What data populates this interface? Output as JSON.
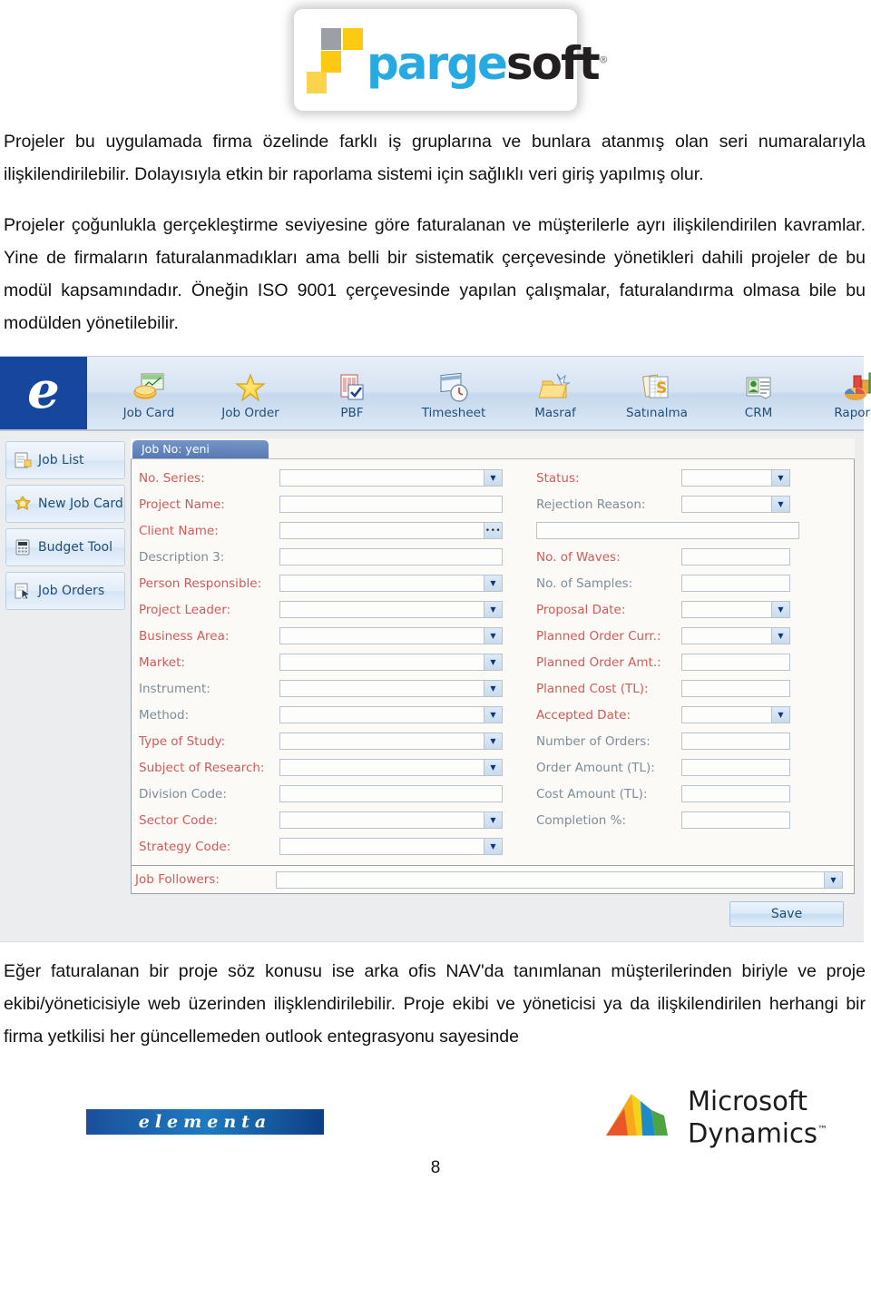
{
  "header": {
    "logo": {
      "brand_part1": "parge",
      "brand_part2": "soft",
      "registered": "®",
      "alt": "pargesoft-logo"
    }
  },
  "document": {
    "paragraph1": "Projeler bu uygulamada firma özelinde farklı iş gruplarına ve bunlara atanmış olan seri numaralarıyla ilişkilendirilebilir. Dolayısıyla etkin bir raporlama sistemi için sağlıklı veri giriş yapılmış olur.",
    "paragraph2": "Projeler çoğunlukla gerçekleştirme seviyesine göre faturalanan ve müşterilerle ayrı ilişkilendirilen kavramlar. Yine de firmaların faturalanmadıkları ama belli bir sistematik çerçevesinde yönetikleri dahili projeler de bu modül kapsamındadır. Öneğin ISO 9001 çerçevesinde yapılan çalışmalar, faturalandırma olmasa bile bu modülden yönetilebilir.",
    "paragraph3": "Eğer faturalanan bir proje söz konusu ise arka ofis NAV'da tanımlanan müşterilerinden biriyle ve proje ekibi/yöneticisiyle web üzerinden ilişklendirilebilir. Proje ekibi ve yöneticisi ya da ilişkilendirilen herhangi bir firma yetkilisi her güncellemeden outlook entegrasyonu sayesinde",
    "page_number": "8"
  },
  "app": {
    "logo_letter": "e",
    "toolbar": [
      {
        "label": "Job Card",
        "icon": "job-card-icon"
      },
      {
        "label": "Job Order",
        "icon": "job-order-star-icon"
      },
      {
        "label": "PBF",
        "icon": "pbf-document-icon"
      },
      {
        "label": "Timesheet",
        "icon": "timesheet-clock-icon"
      },
      {
        "label": "Masraf",
        "icon": "expense-folder-icon"
      },
      {
        "label": "Satınalma",
        "icon": "purchasing-icon"
      },
      {
        "label": "CRM",
        "icon": "crm-contact-icon"
      },
      {
        "label": "Raporlar",
        "icon": "reports-chart-icon"
      }
    ],
    "sidebar": [
      {
        "label": "Job List",
        "icon": "job-list-icon"
      },
      {
        "label": "New Job Card",
        "icon": "new-job-card-icon"
      },
      {
        "label": "Budget Tool",
        "icon": "calculator-icon"
      },
      {
        "label": "Job Orders",
        "icon": "job-orders-icon"
      }
    ],
    "panel": {
      "tab_title": "Job No: yeni",
      "left_fields": [
        {
          "label": "No. Series:",
          "required": true,
          "control": "dropdown",
          "value": ""
        },
        {
          "label": "Project Name:",
          "required": true,
          "control": "text",
          "value": ""
        },
        {
          "label": "Client Name:",
          "required": true,
          "control": "lookup",
          "value": ""
        },
        {
          "label": "Description 3:",
          "required": false,
          "control": "text",
          "value": ""
        },
        {
          "label": "Person Responsible:",
          "required": true,
          "control": "dropdown",
          "value": ""
        },
        {
          "label": "Project Leader:",
          "required": true,
          "control": "dropdown",
          "value": ""
        },
        {
          "label": "Business Area:",
          "required": true,
          "control": "dropdown",
          "value": ""
        },
        {
          "label": "Market:",
          "required": true,
          "control": "dropdown",
          "value": ""
        },
        {
          "label": "Instrument:",
          "required": false,
          "control": "dropdown",
          "value": ""
        },
        {
          "label": "Method:",
          "required": false,
          "control": "dropdown",
          "value": ""
        },
        {
          "label": "Type of Study:",
          "required": true,
          "control": "dropdown",
          "value": ""
        },
        {
          "label": "Subject of Research:",
          "required": true,
          "control": "dropdown",
          "value": ""
        },
        {
          "label": "Division Code:",
          "required": false,
          "control": "text",
          "value": ""
        },
        {
          "label": "Sector Code:",
          "required": true,
          "control": "dropdown",
          "value": ""
        },
        {
          "label": "Strategy Code:",
          "required": true,
          "control": "dropdown",
          "value": ""
        }
      ],
      "right_fields": [
        {
          "label": "Status:",
          "required": true,
          "control": "dropdown",
          "value": ""
        },
        {
          "label": "Rejection Reason:",
          "required": false,
          "control": "dropdown",
          "value": ""
        },
        {
          "label": "",
          "required": false,
          "control": "text-wide",
          "value": ""
        },
        {
          "label": "No. of Waves:",
          "required": true,
          "control": "text",
          "value": ""
        },
        {
          "label": "No. of Samples:",
          "required": false,
          "control": "text",
          "value": ""
        },
        {
          "label": "Proposal Date:",
          "required": true,
          "control": "dropdown",
          "value": ""
        },
        {
          "label": "Planned Order Curr.:",
          "required": true,
          "control": "dropdown",
          "value": ""
        },
        {
          "label": "Planned Order Amt.:",
          "required": true,
          "control": "text",
          "value": ""
        },
        {
          "label": "Planned Cost (TL):",
          "required": true,
          "control": "text",
          "value": ""
        },
        {
          "label": "Accepted Date:",
          "required": true,
          "control": "dropdown",
          "value": ""
        },
        {
          "label": "Number of Orders:",
          "required": false,
          "control": "text",
          "value": ""
        },
        {
          "label": "Order Amount (TL):",
          "required": false,
          "control": "text",
          "value": ""
        },
        {
          "label": "Cost Amount (TL):",
          "required": false,
          "control": "text",
          "value": ""
        },
        {
          "label": "Completion %:",
          "required": false,
          "control": "text",
          "value": ""
        }
      ],
      "followers": {
        "label": "Job Followers:",
        "required": true,
        "value": ""
      },
      "save_label": "Save"
    }
  },
  "footer": {
    "elementa_label": "elementa",
    "microsoft_line1": "Microsoft",
    "microsoft_line2": "Dynamics",
    "microsoft_tm": "™"
  },
  "colors": {
    "accent_blue": "#15479e",
    "brand_yellow": "#fdc913",
    "brand_grey": "#9b9fa6",
    "logo_cyan": "#27a9e1",
    "required_label": "#d05a5a",
    "optional_label": "#7d8c99",
    "toolbar_label": "#1f4e79"
  }
}
